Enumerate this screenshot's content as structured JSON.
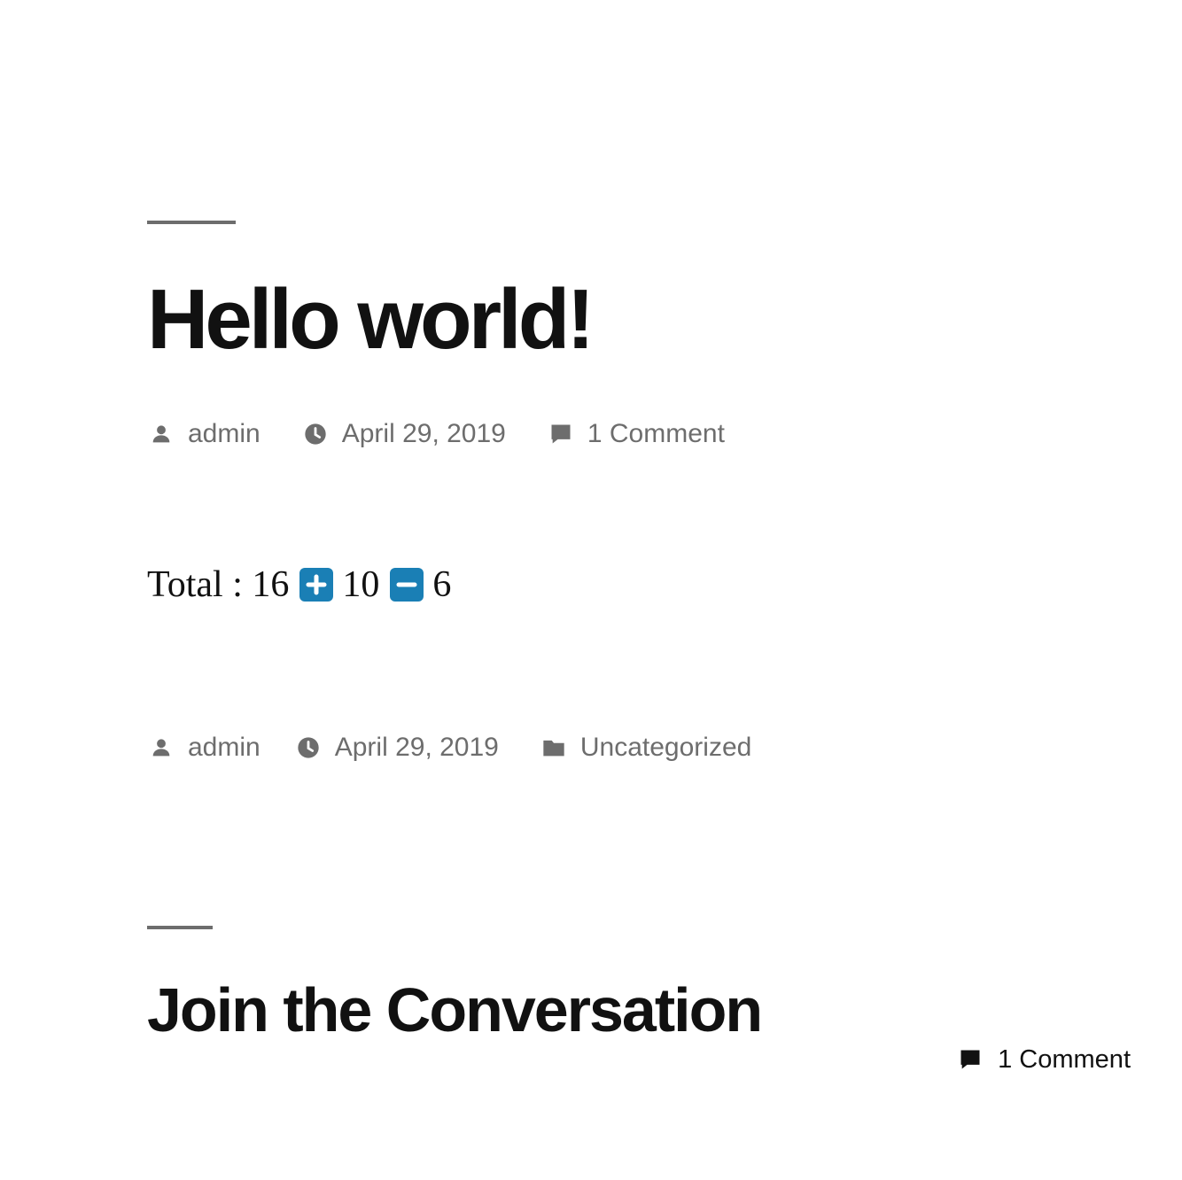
{
  "colors": {
    "text": "#111111",
    "meta": "#6d6d6d",
    "vote_button": "#1a7fb5",
    "background": "#ffffff"
  },
  "post": {
    "title": "Hello world!",
    "meta_top": {
      "author": "admin",
      "date": "April 29, 2019",
      "comments": "1 Comment",
      "icons": [
        "user-icon",
        "clock-icon",
        "comment-icon"
      ]
    },
    "votes": {
      "label": "Total : 16",
      "up_count": "10",
      "down_count": "6",
      "icons": [
        "plus-icon",
        "minus-icon"
      ]
    },
    "meta_bottom": {
      "author": "admin",
      "date": "April 29, 2019",
      "category": "Uncategorized",
      "icons": [
        "user-icon",
        "clock-icon",
        "folder-icon"
      ]
    }
  },
  "comments_section": {
    "title": "Join the Conversation",
    "count": "1 Comment",
    "icon": "comment-icon"
  }
}
